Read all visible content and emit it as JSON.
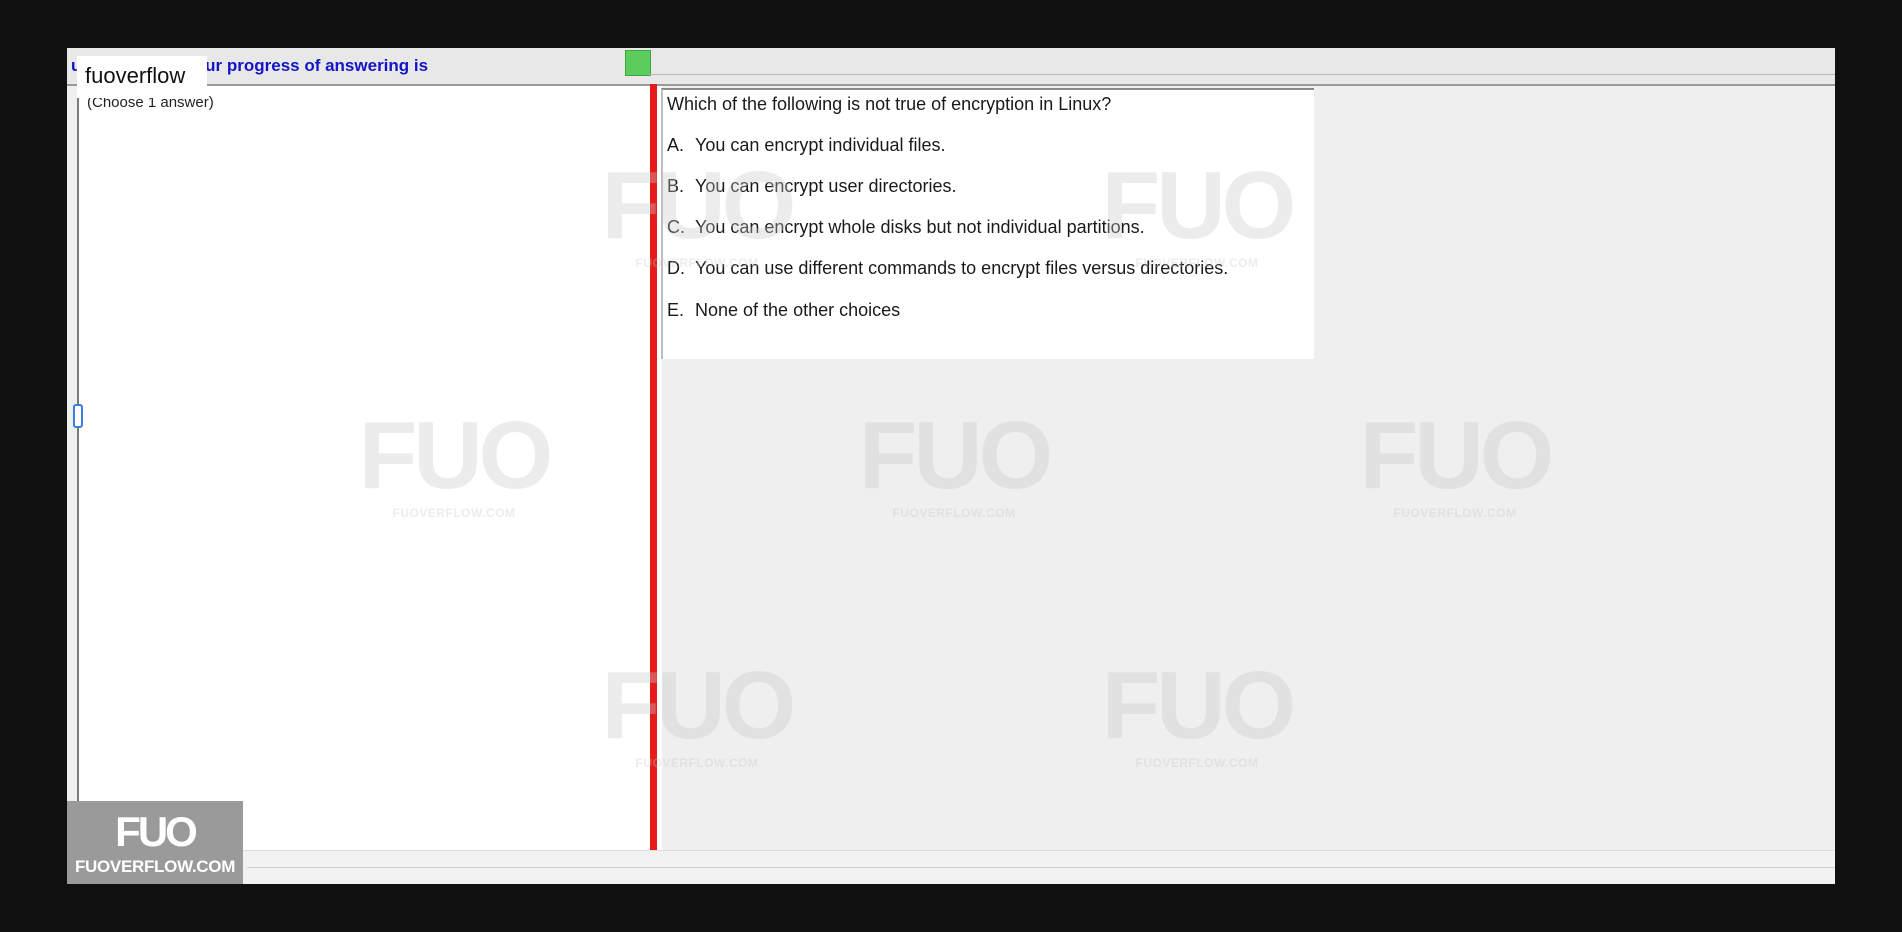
{
  "header": {
    "progress_text": "uestions, and your progress of answering is",
    "progress_color": "#5ccc5c"
  },
  "brand_tag": "fuoverflow",
  "left_panel": {
    "hint": "(Choose 1 answer)"
  },
  "question": {
    "text": "Which of the following is not true of encryption in Linux?",
    "answers": [
      {
        "letter": "A.",
        "text": "You can encrypt individual files."
      },
      {
        "letter": "B.",
        "text": "You can encrypt user directories."
      },
      {
        "letter": "C.",
        "text": "You can encrypt whole disks but not individual partitions."
      },
      {
        "letter": "D.",
        "text": "You can use different commands to encrypt files versus directories."
      },
      {
        "letter": "E.",
        "text": "None of the other choices"
      }
    ]
  },
  "watermark": {
    "logo": "FUO",
    "url": "FUOVERFLOW.COM"
  },
  "logo_badge": {
    "mark": "FUO",
    "url": "FUOVERFLOW.COM"
  },
  "colors": {
    "splitter": "#e51c1c",
    "progress_text": "#1414c8"
  }
}
